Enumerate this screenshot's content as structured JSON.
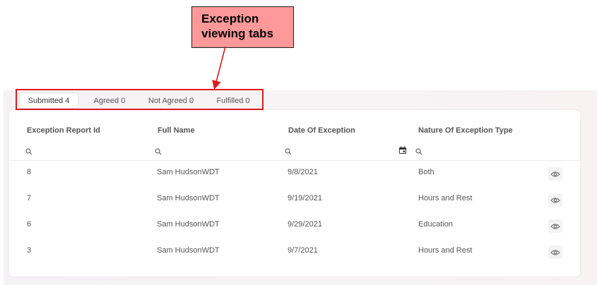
{
  "annotation": {
    "callout_line1": "Exception",
    "callout_line2": "viewing tabs"
  },
  "tabs": [
    {
      "label": "Submitted 4",
      "active": true
    },
    {
      "label": "Agreed 0",
      "active": false
    },
    {
      "label": "Not Agreed 0",
      "active": false
    },
    {
      "label": "Fulfilled 0",
      "active": false
    }
  ],
  "table": {
    "columns": [
      "Exception Report Id",
      "Full Name",
      "Date Of Exception",
      "Nature Of Exception Type"
    ],
    "rows": [
      {
        "id": "8",
        "name": "Sam HudsonWDT",
        "date": "9/8/2021",
        "nature": "Both"
      },
      {
        "id": "7",
        "name": "Sam HudsonWDT",
        "date": "9/19/2021",
        "nature": "Hours and Rest"
      },
      {
        "id": "6",
        "name": "Sam HudsonWDT",
        "date": "9/29/2021",
        "nature": "Education"
      },
      {
        "id": "3",
        "name": "Sam HudsonWDT",
        "date": "9/7/2021",
        "nature": "Hours and Rest"
      }
    ]
  },
  "icons": {
    "filter": "search-icon",
    "date_picker": "calendar-icon",
    "view": "eye-icon"
  },
  "colors": {
    "callout_fill": "#ff9999",
    "highlight_outline": "#e01a1a",
    "arrow": "#e01a1a"
  }
}
